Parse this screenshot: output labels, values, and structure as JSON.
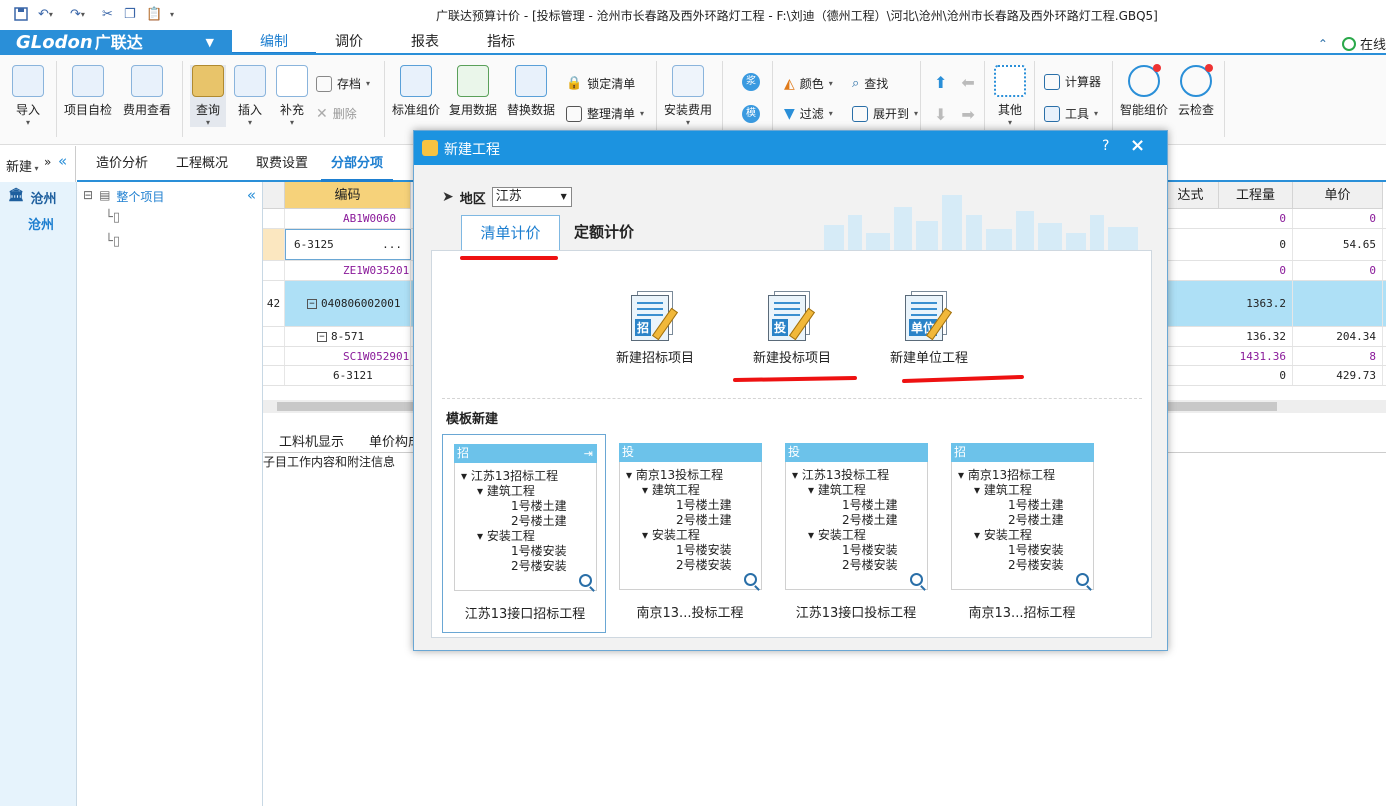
{
  "app": {
    "title": "广联达预算计价 - [投标管理 - 沧州市长春路及西外环路灯工程 - F:\\刘迪（德州工程）\\河北\\沧州\\沧州市长春路及西外环路灯工程.GBQ5]",
    "logo": "GLodon",
    "logo_cn": "广联达",
    "online_label": "在线"
  },
  "menu": {
    "tabs": [
      {
        "label": "编制",
        "active": true
      },
      {
        "label": "调价",
        "active": false
      },
      {
        "label": "报表",
        "active": false
      },
      {
        "label": "指标",
        "active": false
      }
    ]
  },
  "ribbon": {
    "import": "导入",
    "self_check": "项目自检",
    "fee_view": "费用查看",
    "query": "查询",
    "insert": "插入",
    "supplement": "补充",
    "archive": "存档",
    "delete": "删除",
    "std_price": "标准组价",
    "reuse_data": "复用数据",
    "replace_data": "替换数据",
    "lock_list": "锁定清单",
    "organize_list": "整理清单",
    "install_fee": "安装费用",
    "color": "颜色",
    "find": "查找",
    "filter": "过滤",
    "expand_to": "展开到",
    "other": "其他",
    "calculator": "计算器",
    "tools": "工具",
    "smart_price": "智能组价",
    "cloud_check": "云检查",
    "circle1": "浆",
    "circle2": "模"
  },
  "leftnav": {
    "new_label": "新建",
    "project": "沧州",
    "sub": "沧州"
  },
  "tree": {
    "root": "整个项目"
  },
  "content_tabs": [
    {
      "label": "造价分析",
      "active": false
    },
    {
      "label": "工程概况",
      "active": false
    },
    {
      "label": "取费设置",
      "active": false
    },
    {
      "label": "分部分项",
      "active": true
    }
  ],
  "grid": {
    "headers": {
      "code": "编码",
      "expr": "达式",
      "qty": "工程量",
      "price": "单价"
    },
    "rows": [
      {
        "num": "",
        "code": "AB1W0060",
        "qty": "0",
        "price": "0",
        "purple": true
      },
      {
        "num": "",
        "code": "6-3125",
        "qty": "0",
        "price": "54.65",
        "purple": false,
        "editing": true
      },
      {
        "num": "",
        "code": "ZE1W035201",
        "qty": "0",
        "price": "0",
        "purple": true
      },
      {
        "num": "42",
        "code": "040806002001",
        "qty": "1363.2",
        "price": "",
        "purple": false,
        "highlight": true
      },
      {
        "num": "",
        "code": "8-571",
        "qty": "136.32",
        "price": "204.34",
        "purple": false
      },
      {
        "num": "",
        "code": "SC1W052901",
        "qty": "1431.36",
        "price": "8",
        "purple": true
      },
      {
        "num": "",
        "code": "6-3121",
        "qty": "0",
        "price": "429.73",
        "purple": false
      }
    ]
  },
  "bottom": {
    "tab1": "工料机显示",
    "tab2": "单价构成",
    "info": "子目工作内容和附注信息"
  },
  "dialog": {
    "title": "新建工程",
    "help": "?",
    "close": "×",
    "region_label": "地区",
    "region_value": "江苏",
    "tab_list": "清单计价",
    "tab_quota": "定额计价",
    "btn_bid_invite": {
      "label": "新建招标项目",
      "badge": "招"
    },
    "btn_bid_submit": {
      "label": "新建投标项目",
      "badge": "投"
    },
    "btn_unit": {
      "label": "新建单位工程",
      "badge": "单位"
    },
    "template_title": "模板新建",
    "templates": [
      {
        "badge": "招",
        "root": "江苏13招标工程",
        "name": "江苏13接口招标工程",
        "selected": true
      },
      {
        "badge": "投",
        "root": "南京13投标工程",
        "name": "南京13...投标工程",
        "selected": false
      },
      {
        "badge": "投",
        "root": "江苏13投标工程",
        "name": "江苏13接口投标工程",
        "selected": false
      },
      {
        "badge": "招",
        "root": "南京13招标工程",
        "name": "南京13...招标工程",
        "selected": false
      }
    ],
    "tree_labels": {
      "build": "建筑工程",
      "b1": "1号楼土建",
      "b2": "2号楼土建",
      "install": "安装工程",
      "i1": "1号楼安装",
      "i2": "2号楼安装"
    }
  },
  "colors": {
    "brand": "#2a8fd8",
    "dialog_title": "#1c93e0",
    "annotation": "#e11111"
  }
}
